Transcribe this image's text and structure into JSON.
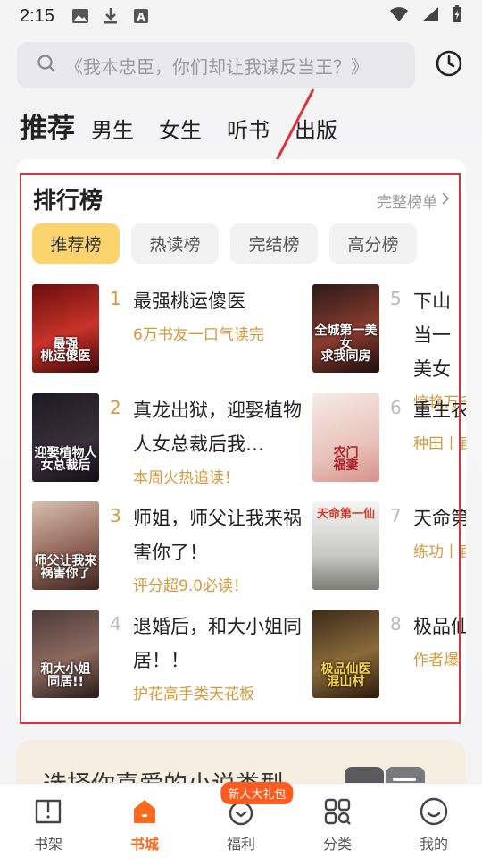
{
  "status": {
    "time": "2:15"
  },
  "search": {
    "placeholder": "《我本忠臣，你们却让我谋反当王？》"
  },
  "channels": [
    "推荐",
    "男生",
    "女生",
    "听书",
    "出版"
  ],
  "ranking": {
    "title": "排行榜",
    "more_label": "完整榜单",
    "sub_tabs": [
      "推荐榜",
      "热读榜",
      "完结榜",
      "高分榜"
    ],
    "books": [
      {
        "rank": "1",
        "name": "最强桃运傻医",
        "tag": "6万书友一口气读完",
        "cover_text": "最强\n桃运傻医"
      },
      {
        "rank": "2",
        "name": "真龙出狱，迎娶植物人女总裁后我…",
        "tag": "本周火热追读！",
        "cover_text": "迎娶植物人\n女总裁后"
      },
      {
        "rank": "3",
        "name": "师姐，师父让我来祸害你了！",
        "tag": "评分超9.0必读！",
        "cover_text": "师父让我来\n祸害你了"
      },
      {
        "rank": "4",
        "name": "退婚后，和大小姐同居！！",
        "tag": "护花高手类天花板",
        "cover_text": "和大小姐\n同居!!"
      },
      {
        "rank": "5",
        "name": "下山当一美女",
        "tag": "惊艳万千",
        "cover_text": "全城第一美女\n求我同房"
      },
      {
        "rank": "6",
        "name": "重生农",
        "tag": "种田丨官",
        "cover_text": "农门\n福妻"
      },
      {
        "rank": "7",
        "name": "天命第",
        "tag": "练功丨官",
        "cover_text": "天命第一仙"
      },
      {
        "rank": "8",
        "name": "极品仙",
        "tag": "作者爆",
        "cover_text": "极品仙医\n混山村"
      }
    ]
  },
  "genre_card": {
    "title": "选择你喜爱的小说类型"
  },
  "bottom_nav": {
    "items": [
      "书架",
      "书城",
      "福利",
      "分类",
      "我的"
    ],
    "badge": "新人大礼包"
  },
  "colors": {
    "accent": "#ff6a1f",
    "gold": "#d69a3c",
    "tab_active": "#fbd46d",
    "outline": "#d9343a"
  }
}
